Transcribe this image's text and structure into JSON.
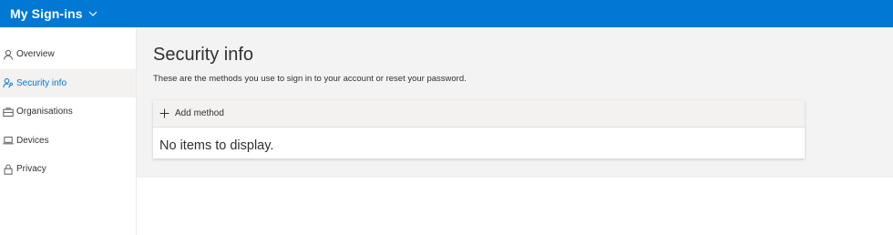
{
  "header": {
    "app_title": "My Sign-ins",
    "accent_color": "#0078d4",
    "switcher_icon": "chevron-down-icon"
  },
  "sidebar": {
    "items": [
      {
        "label": "Overview",
        "icon": "person-icon",
        "active": false
      },
      {
        "label": "Security info",
        "icon": "person-key-icon",
        "active": true
      },
      {
        "label": "Organisations",
        "icon": "briefcase-icon",
        "active": false
      },
      {
        "label": "Devices",
        "icon": "laptop-icon",
        "active": false
      },
      {
        "label": "Privacy",
        "icon": "lock-icon",
        "active": false
      }
    ]
  },
  "main": {
    "title": "Security info",
    "description": "These are the methods you use to sign in to your account or reset your password.",
    "add_method_label": "Add method",
    "add_method_icon": "plus-icon",
    "empty_message": "No items to display."
  }
}
